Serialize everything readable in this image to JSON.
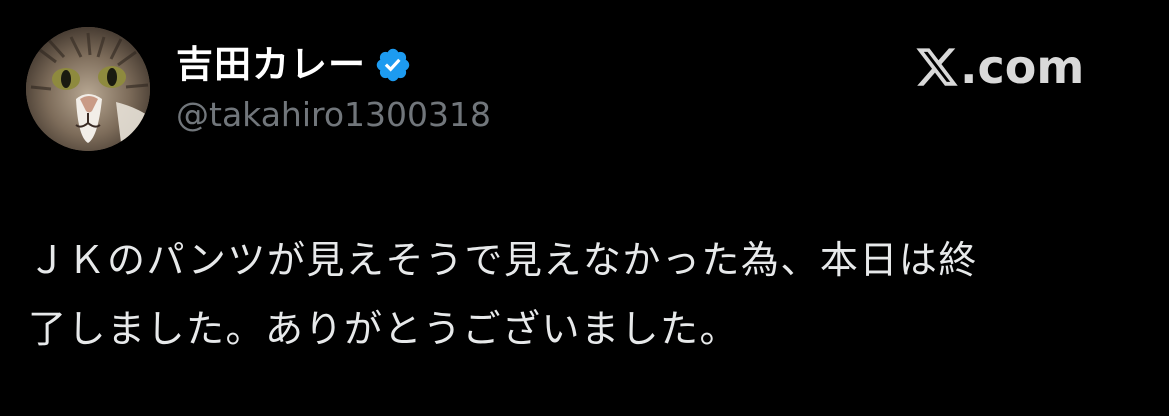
{
  "profile": {
    "display_name": "吉田カレー",
    "handle": "@takahiro1300318",
    "avatar": "cat-face-avatar",
    "verified_icon": "verified-badge-icon"
  },
  "brand": {
    "icon": "x-logo-icon",
    "text": ".com"
  },
  "tweet": {
    "line1": "ＪＫのパンツが見えそうで見えなかった為、本日は終",
    "line2": "了しました。ありがとうございました。"
  },
  "colors": {
    "background": "#000000",
    "name": "#ffffff",
    "handle": "#71767b",
    "body_text": "#e7e9ea",
    "verified": "#1d9bf0",
    "brand": "#d9d9d9"
  }
}
